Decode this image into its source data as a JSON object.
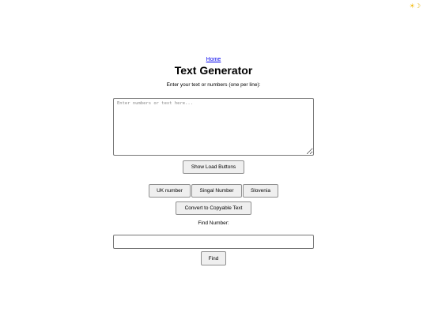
{
  "theme_toggle": {
    "sun": "☀",
    "moon": "☽"
  },
  "nav": {
    "home_label": "Home"
  },
  "header": {
    "title": "Text Generator"
  },
  "input": {
    "instruction": "Enter your text or numbers (one per line):",
    "placeholder": "Enter numbers or text here...",
    "value": ""
  },
  "buttons": {
    "show_load": "Show Load Buttons",
    "uk_number": "UK number",
    "singal_number": "Singal Number",
    "slovenia": "Slovenia",
    "convert": "Convert to Copyable Text",
    "find": "Find"
  },
  "find": {
    "label": "Find Number:",
    "value": ""
  },
  "colors": {
    "link": "#0000ee",
    "button_bg": "#efefef",
    "border": "#767676"
  }
}
